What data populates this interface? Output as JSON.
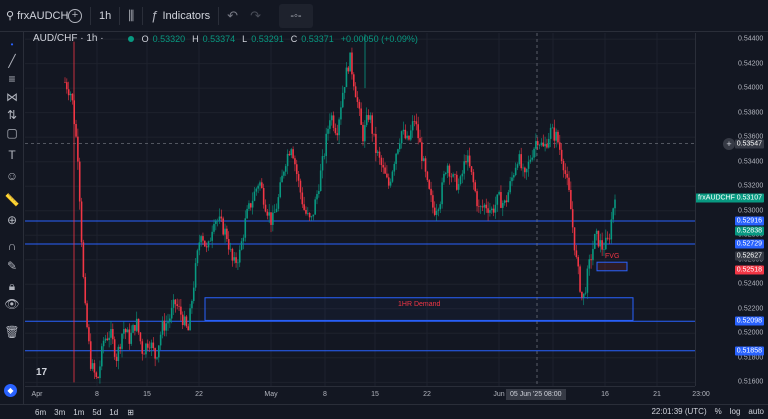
{
  "toolbar": {
    "symbol": "frxAUDCH",
    "interval": "1h",
    "indicators_label": "Indicators"
  },
  "legend": {
    "symbol": "AUD/CHF · 1h ·",
    "o_label": "O",
    "o_val": "0.53320",
    "h_label": "H",
    "h_val": "0.53374",
    "l_label": "L",
    "l_val": "0.53291",
    "c_label": "C",
    "c_val": "0.53371",
    "change": "+0.00050 (+0.09%)"
  },
  "chart_data": {
    "type": "candlestick",
    "ylim": [
      0.5157,
      0.5445
    ],
    "y_ticks": [
      0.544,
      0.542,
      0.54,
      0.538,
      0.536,
      0.534,
      0.532,
      0.53,
      0.528,
      0.526,
      0.524,
      0.522,
      0.52,
      0.518,
      0.516
    ],
    "y_tick_labels": [
      "0.54400",
      "0.54200",
      "0.54000",
      "0.53800",
      "0.53600",
      "0.53400",
      "0.53200",
      "0.53000",
      "0.52800",
      "0.52600",
      "0.52400",
      "0.52200",
      "0.52000",
      "0.51800",
      "0.51600"
    ],
    "x_ticks": [
      "Apr",
      "8",
      "15",
      "22",
      "May",
      "8",
      "15",
      "22",
      "Jun",
      "9",
      "16",
      "21",
      "23:00"
    ],
    "close_path": [
      0.5405,
      0.5395,
      0.5345,
      0.5225,
      0.5175,
      0.516,
      0.5195,
      0.52,
      0.518,
      0.5205,
      0.5195,
      0.521,
      0.5185,
      0.5195,
      0.518,
      0.5205,
      0.521,
      0.5225,
      0.5215,
      0.52,
      0.5245,
      0.5285,
      0.5265,
      0.5295,
      0.529,
      0.528,
      0.5255,
      0.5265,
      0.5295,
      0.531,
      0.5325,
      0.5305,
      0.529,
      0.531,
      0.534,
      0.5355,
      0.5325,
      0.53,
      0.529,
      0.5315,
      0.5345,
      0.538,
      0.5365,
      0.54,
      0.5425,
      0.5395,
      0.536,
      0.538,
      0.535,
      0.5335,
      0.532,
      0.5345,
      0.5365,
      0.5355,
      0.5375,
      0.535,
      0.532,
      0.53,
      0.531,
      0.534,
      0.5325,
      0.532,
      0.5345,
      0.5325,
      0.53,
      0.5305,
      0.53,
      0.531,
      0.5305,
      0.5325,
      0.5345,
      0.5325,
      0.5345,
      0.536,
      0.535,
      0.5365,
      0.536,
      0.534,
      0.531,
      0.526,
      0.5225,
      0.5255,
      0.528,
      0.527,
      0.5275,
      0.5315
    ],
    "price_lines": [
      0.52916,
      0.52729,
      0.52098,
      0.51858
    ],
    "price_labels": [
      {
        "text": "0.53547",
        "price": 0.53547,
        "color": "#363a45"
      },
      {
        "text": "0.53107",
        "price": 0.53107,
        "color": "#089981"
      },
      {
        "text": "0.52916",
        "price": 0.52916,
        "color": "#2962ff"
      },
      {
        "text": "0.52838",
        "price": 0.52838,
        "color": "#089981"
      },
      {
        "text": "0.52729",
        "price": 0.52729,
        "color": "#2962ff"
      },
      {
        "text": "0.52627",
        "price": 0.52627,
        "color": "#363a45"
      },
      {
        "text": "0.52518",
        "price": 0.52518,
        "color": "#f23645"
      },
      {
        "text": "0.52098",
        "price": 0.52098,
        "color": "#2962ff"
      },
      {
        "text": "0.51858",
        "price": 0.51858,
        "color": "#2962ff"
      }
    ],
    "crosshair_price": 0.53547,
    "demand_zone": {
      "label": "1HR Demand",
      "top": 0.5229,
      "bottom": 0.52105
    },
    "fvg_zone": {
      "label": "FVG",
      "top": 0.5258,
      "bottom": 0.5251
    },
    "colors": {
      "up": "#089981",
      "down": "#f23645",
      "lines": "#2962ff",
      "bg": "#131722",
      "grid": "#1e222d"
    }
  },
  "price_scale": {
    "symbol_tag": "frxAUDCHF",
    "crosshair_label": "0.53547"
  },
  "time_scale": {
    "crosshair_label": "05 Jun '25   08:00"
  },
  "bottom": {
    "ranges": [
      "6m",
      "3m",
      "1m",
      "5d",
      "1d"
    ],
    "time": "22:01:39 (UTC)",
    "pct": "%",
    "log": "log",
    "auto": "auto"
  }
}
